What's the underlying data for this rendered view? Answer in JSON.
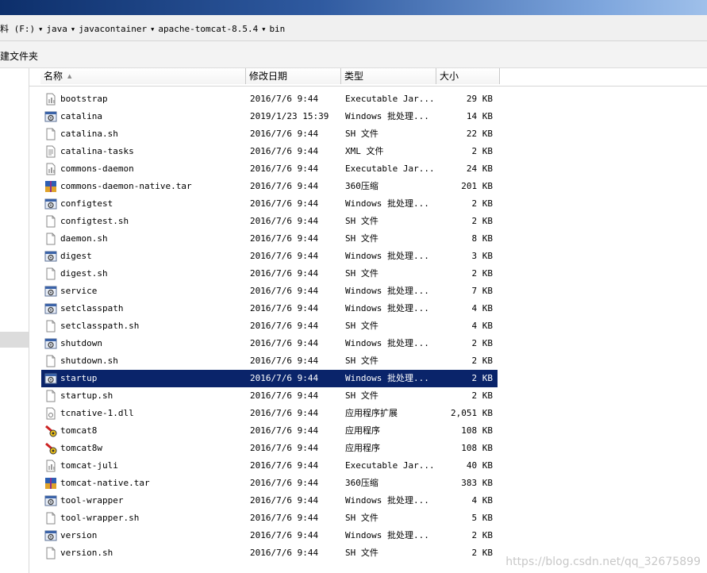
{
  "address": {
    "crumbs": [
      "料 (F:)",
      "java",
      "javacontainer",
      "apache-tomcat-8.5.4",
      "bin"
    ]
  },
  "toolbar": {
    "new_folder_label": "建文件夹"
  },
  "columns": {
    "name": "名称",
    "date": "修改日期",
    "type": "类型",
    "size": "大小"
  },
  "files": [
    {
      "name": "bootstrap",
      "date": "2016/7/6 9:44",
      "type": "Executable Jar...",
      "size": "29 KB",
      "icon": "jar-icon"
    },
    {
      "name": "catalina",
      "date": "2019/1/23 15:39",
      "type": "Windows 批处理...",
      "size": "14 KB",
      "icon": "batch-icon"
    },
    {
      "name": "catalina.sh",
      "date": "2016/7/6 9:44",
      "type": "SH 文件",
      "size": "22 KB",
      "icon": "file-icon"
    },
    {
      "name": "catalina-tasks",
      "date": "2016/7/6 9:44",
      "type": "XML 文件",
      "size": "2 KB",
      "icon": "xml-icon"
    },
    {
      "name": "commons-daemon",
      "date": "2016/7/6 9:44",
      "type": "Executable Jar...",
      "size": "24 KB",
      "icon": "jar-icon"
    },
    {
      "name": "commons-daemon-native.tar",
      "date": "2016/7/6 9:44",
      "type": "360压缩",
      "size": "201 KB",
      "icon": "archive-icon"
    },
    {
      "name": "configtest",
      "date": "2016/7/6 9:44",
      "type": "Windows 批处理...",
      "size": "2 KB",
      "icon": "batch-icon"
    },
    {
      "name": "configtest.sh",
      "date": "2016/7/6 9:44",
      "type": "SH 文件",
      "size": "2 KB",
      "icon": "file-icon"
    },
    {
      "name": "daemon.sh",
      "date": "2016/7/6 9:44",
      "type": "SH 文件",
      "size": "8 KB",
      "icon": "file-icon"
    },
    {
      "name": "digest",
      "date": "2016/7/6 9:44",
      "type": "Windows 批处理...",
      "size": "3 KB",
      "icon": "batch-icon"
    },
    {
      "name": "digest.sh",
      "date": "2016/7/6 9:44",
      "type": "SH 文件",
      "size": "2 KB",
      "icon": "file-icon"
    },
    {
      "name": "service",
      "date": "2016/7/6 9:44",
      "type": "Windows 批处理...",
      "size": "7 KB",
      "icon": "batch-icon"
    },
    {
      "name": "setclasspath",
      "date": "2016/7/6 9:44",
      "type": "Windows 批处理...",
      "size": "4 KB",
      "icon": "batch-icon"
    },
    {
      "name": "setclasspath.sh",
      "date": "2016/7/6 9:44",
      "type": "SH 文件",
      "size": "4 KB",
      "icon": "file-icon"
    },
    {
      "name": "shutdown",
      "date": "2016/7/6 9:44",
      "type": "Windows 批处理...",
      "size": "2 KB",
      "icon": "batch-icon"
    },
    {
      "name": "shutdown.sh",
      "date": "2016/7/6 9:44",
      "type": "SH 文件",
      "size": "2 KB",
      "icon": "file-icon"
    },
    {
      "name": "startup",
      "date": "2016/7/6 9:44",
      "type": "Windows 批处理...",
      "size": "2 KB",
      "icon": "batch-icon",
      "selected": true
    },
    {
      "name": "startup.sh",
      "date": "2016/7/6 9:44",
      "type": "SH 文件",
      "size": "2 KB",
      "icon": "file-icon"
    },
    {
      "name": "tcnative-1.dll",
      "date": "2016/7/6 9:44",
      "type": "应用程序扩展",
      "size": "2,051 KB",
      "icon": "dll-icon"
    },
    {
      "name": "tomcat8",
      "date": "2016/7/6 9:44",
      "type": "应用程序",
      "size": "108 KB",
      "icon": "tomcat-icon"
    },
    {
      "name": "tomcat8w",
      "date": "2016/7/6 9:44",
      "type": "应用程序",
      "size": "108 KB",
      "icon": "tomcat-icon"
    },
    {
      "name": "tomcat-juli",
      "date": "2016/7/6 9:44",
      "type": "Executable Jar...",
      "size": "40 KB",
      "icon": "jar-icon"
    },
    {
      "name": "tomcat-native.tar",
      "date": "2016/7/6 9:44",
      "type": "360压缩",
      "size": "383 KB",
      "icon": "archive-icon"
    },
    {
      "name": "tool-wrapper",
      "date": "2016/7/6 9:44",
      "type": "Windows 批处理...",
      "size": "4 KB",
      "icon": "batch-icon"
    },
    {
      "name": "tool-wrapper.sh",
      "date": "2016/7/6 9:44",
      "type": "SH 文件",
      "size": "5 KB",
      "icon": "file-icon"
    },
    {
      "name": "version",
      "date": "2016/7/6 9:44",
      "type": "Windows 批处理...",
      "size": "2 KB",
      "icon": "batch-icon"
    },
    {
      "name": "version.sh",
      "date": "2016/7/6 9:44",
      "type": "SH 文件",
      "size": "2 KB",
      "icon": "file-icon"
    }
  ],
  "watermark": "https://blog.csdn.net/qq_32675899",
  "colors": {
    "selection": "#0a246a",
    "titlebar_dark": "#0d2f6b",
    "titlebar_light": "#9fc0ea"
  }
}
